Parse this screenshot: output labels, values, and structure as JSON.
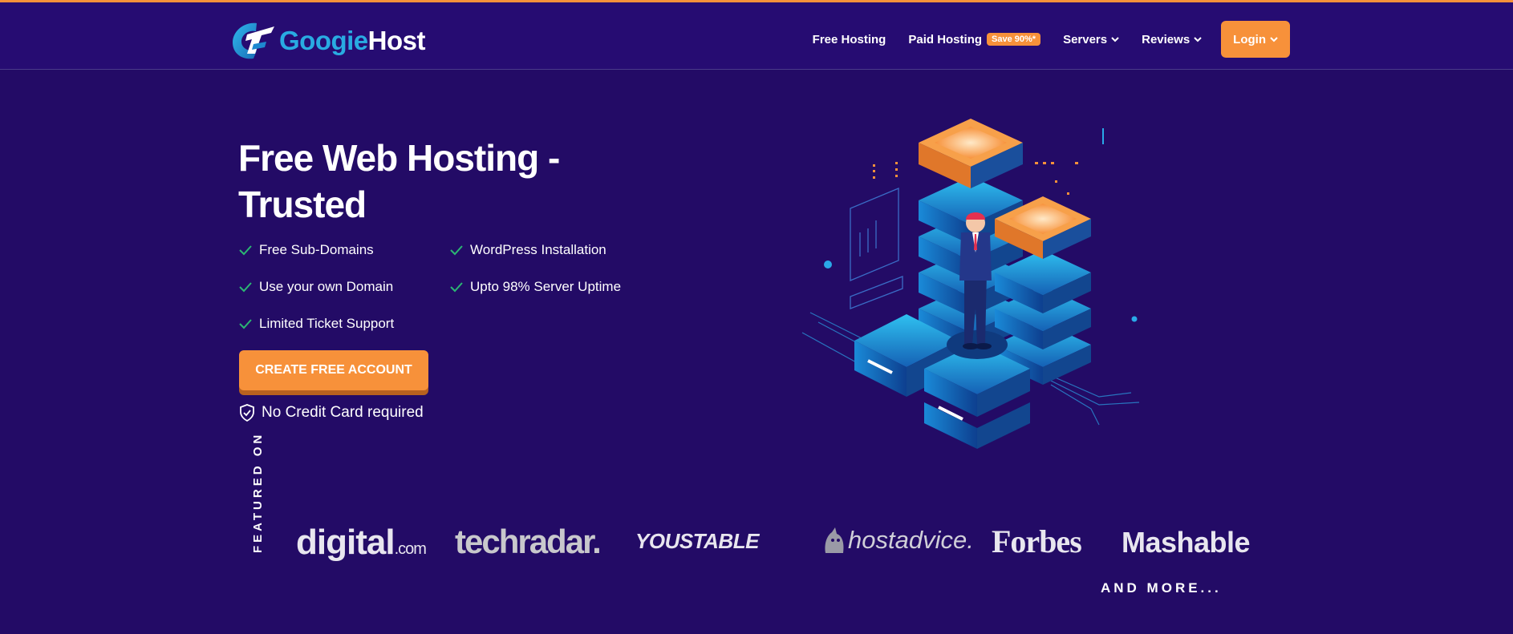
{
  "header": {
    "logo": {
      "part1": "Googie",
      "part2": "Host"
    },
    "nav": [
      {
        "label": "Free Hosting"
      },
      {
        "label": "Paid Hosting",
        "badge": "Save 90%*"
      },
      {
        "label": "Servers"
      },
      {
        "label": "Reviews"
      }
    ],
    "login_label": "Login"
  },
  "hero": {
    "title": "Free Web Hosting - Trusted",
    "features": [
      "Free Sub-Domains",
      "WordPress Installation",
      "Use your own Domain",
      "Upto 98% Server Uptime",
      "Limited Ticket Support"
    ],
    "cta_label": "CREATE FREE ACCOUNT",
    "no_credit_card": "No Credit Card required"
  },
  "featured": {
    "label": "FEATURED ON",
    "brands": {
      "digital": "digital",
      "digital_suffix": ".com",
      "techradar": "techradar.",
      "youstable": "YOUSTABLE",
      "hostadvice": "hostadvice.",
      "forbes": "Forbes",
      "mashable": "Mashable"
    },
    "and_more": "AND MORE..."
  },
  "colors": {
    "background": "#230b66",
    "header": "#260c72",
    "accent_orange": "#f7913a",
    "brand_blue": "#29abe2",
    "check_green": "#2bb673"
  }
}
